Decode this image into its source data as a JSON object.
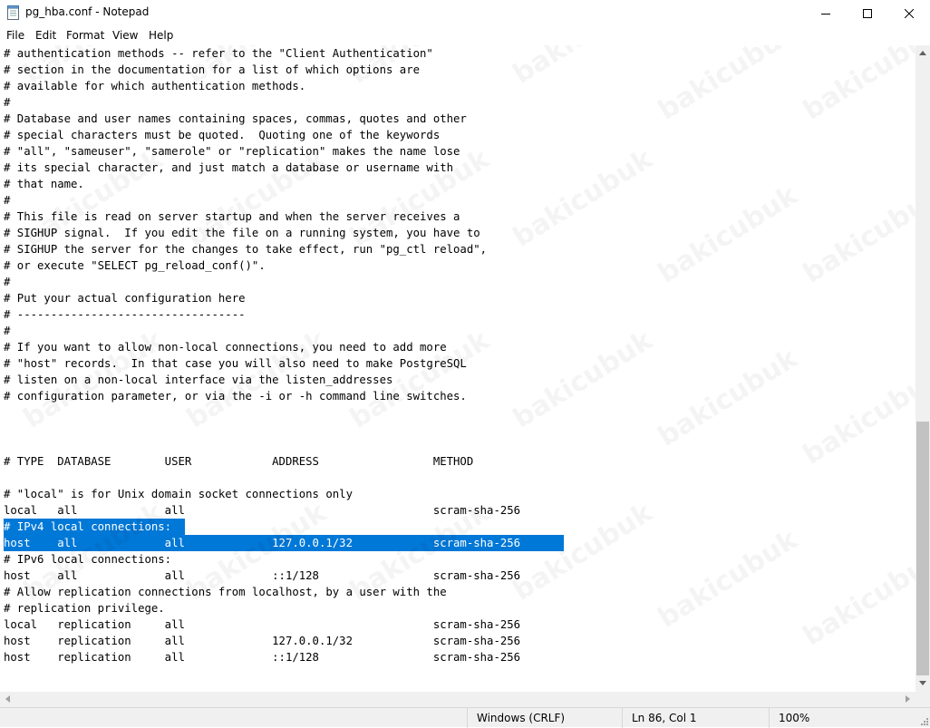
{
  "window": {
    "title": "pg_hba.conf - Notepad"
  },
  "menu": [
    "File",
    "Edit",
    "Format",
    "View",
    "Help"
  ],
  "icons": {
    "app": "notepad-icon",
    "minimize": "minimize-icon",
    "maximize": "maximize-icon",
    "close": "close-icon"
  },
  "lines": [
    "# authentication methods -- refer to the \"Client Authentication\"",
    "# section in the documentation for a list of which options are",
    "# available for which authentication methods.",
    "#",
    "# Database and user names containing spaces, commas, quotes and other",
    "# special characters must be quoted.  Quoting one of the keywords",
    "# \"all\", \"sameuser\", \"samerole\" or \"replication\" makes the name lose",
    "# its special character, and just match a database or username with",
    "# that name.",
    "#",
    "# This file is read on server startup and when the server receives a",
    "# SIGHUP signal.  If you edit the file on a running system, you have to",
    "# SIGHUP the server for the changes to take effect, run \"pg_ctl reload\",",
    "# or execute \"SELECT pg_reload_conf()\".",
    "#",
    "# Put your actual configuration here",
    "# ----------------------------------",
    "#",
    "# If you want to allow non-local connections, you need to add more",
    "# \"host\" records.  In that case you will also need to make PostgreSQL",
    "# listen on a non-local interface via the listen_addresses",
    "# configuration parameter, or via the -i or -h command line switches.",
    "",
    "",
    "",
    "# TYPE  DATABASE        USER            ADDRESS                 METHOD",
    "",
    "# \"local\" is for Unix domain socket connections only",
    "local   all             all                                     scram-sha-256",
    "# IPv4 local connections:",
    "host    all             all             127.0.0.1/32            scram-sha-256",
    "# IPv6 local connections:",
    "host    all             all             ::1/128                 scram-sha-256",
    "# Allow replication connections from localhost, by a user with the",
    "# replication privilege.",
    "local   replication     all                                     scram-sha-256",
    "host    replication     all             127.0.0.1/32            scram-sha-256",
    "host    replication     all             ::1/128                 scram-sha-256"
  ],
  "selected_lines": [
    29,
    30
  ],
  "watermark": "bakicubuk",
  "status": {
    "line_ending": "Windows (CRLF)",
    "position": "Ln 86, Col 1",
    "zoom": "100%"
  },
  "colors": {
    "selection": "#0078d7",
    "statusbar": "#f0f0f0"
  }
}
